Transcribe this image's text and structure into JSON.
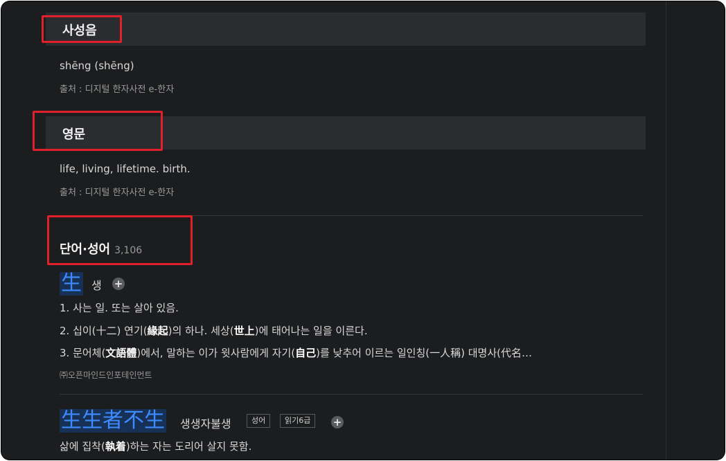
{
  "sections": {
    "sasungeum": {
      "title": "사성음",
      "body": "shēng (shēng)",
      "source": "출처 : 디지털 한자사전 e-한자"
    },
    "english": {
      "title": "영문",
      "body": "life, living, lifetime. birth.",
      "source": "출처 : 디지털 한자사전 e-한자"
    }
  },
  "words": {
    "title": "단어·성어",
    "count": "3,106",
    "entry1": {
      "hanja": "生",
      "reading": "생",
      "defs": [
        {
          "pre": "1. 사는 일. 또는 살아 있음.",
          "b1": "",
          "mid": "",
          "b2": "",
          "post": ""
        },
        {
          "pre": "2. 십이(十二) 연기(",
          "b1": "緣起",
          "mid": ")의 하나. 세상(",
          "b2": "世上",
          "post": ")에 태어나는 일을 이른다."
        },
        {
          "pre": "3. 문어체(",
          "b1": "文語體",
          "mid": ")에서, 말하는 이가 윗사람에게 자기(",
          "b2": "自己",
          "post": ")를 낮추어 이르는 일인칭(一人稱) 대명사(代名…"
        }
      ],
      "provider": "㈜오픈마인드인포테인먼트"
    },
    "entry2": {
      "hanja": "生生者不生",
      "reading": "생생자불생",
      "tag1": "성어",
      "tag2": "읽기6급",
      "def_pre": "삶에 집착(",
      "def_b": "執着",
      "def_post": ")하는 자는 도리어 살지 못함."
    }
  },
  "plus_glyph": "+",
  "colors": {
    "background": "#1c1d1f",
    "section_bar": "#2b2c30",
    "highlight_box": "#e0202a",
    "hanja_blue": "#3d8bff"
  }
}
